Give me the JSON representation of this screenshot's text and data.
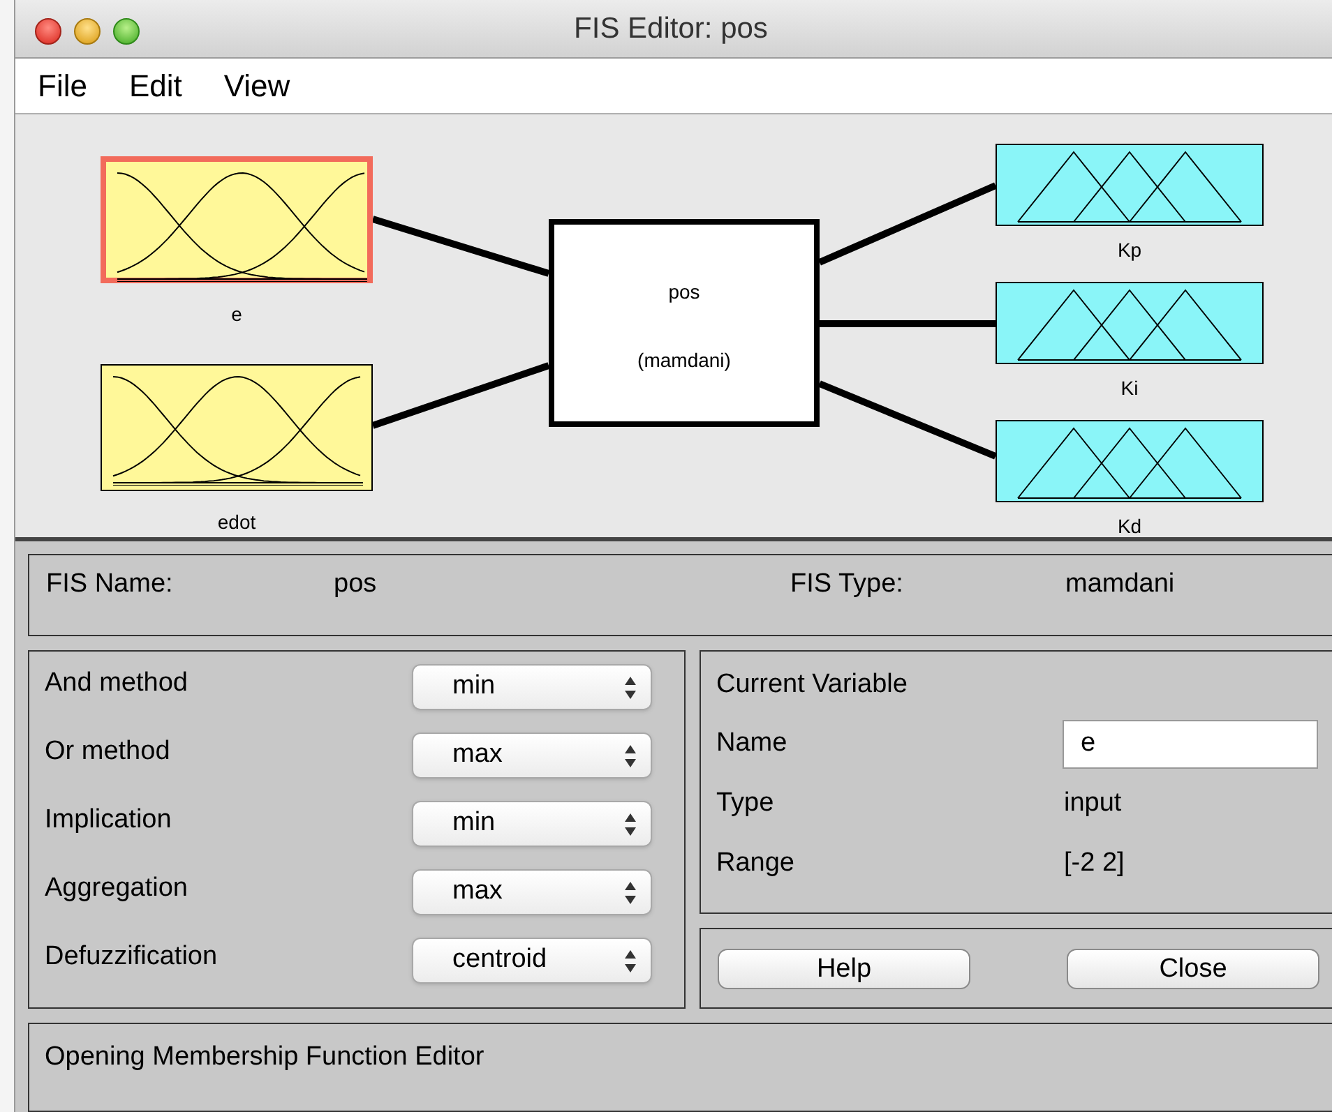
{
  "window": {
    "title": "FIS Editor: pos"
  },
  "menu": [
    "File",
    "Edit",
    "View"
  ],
  "diagram": {
    "inputs": [
      {
        "name": "e",
        "selected": true
      },
      {
        "name": "edot",
        "selected": false
      }
    ],
    "system": {
      "name": "pos",
      "type": "(mamdani)"
    },
    "outputs": [
      {
        "name": "Kp",
        "selected": false
      },
      {
        "name": "Ki",
        "selected": false
      },
      {
        "name": "Kd",
        "selected": false
      }
    ]
  },
  "fis": {
    "name_label": "FIS Name:",
    "name": "pos",
    "type_label": "FIS Type:",
    "type": "mamdani"
  },
  "methods": [
    {
      "label": "And method",
      "value": "min"
    },
    {
      "label": "Or method",
      "value": "max"
    },
    {
      "label": "Implication",
      "value": "min"
    },
    {
      "label": "Aggregation",
      "value": "max"
    },
    {
      "label": "Defuzzification",
      "value": "centroid"
    }
  ],
  "current_variable": {
    "title": "Current Variable",
    "rows": [
      {
        "label": "Name",
        "value": "e",
        "kind": "field"
      },
      {
        "label": "Type",
        "value": "input",
        "kind": "text"
      },
      {
        "label": "Range",
        "value": "[-2 2]",
        "kind": "text"
      }
    ]
  },
  "buttons": [
    "Help",
    "Close"
  ],
  "status": "Opening Membership Function Editor"
}
